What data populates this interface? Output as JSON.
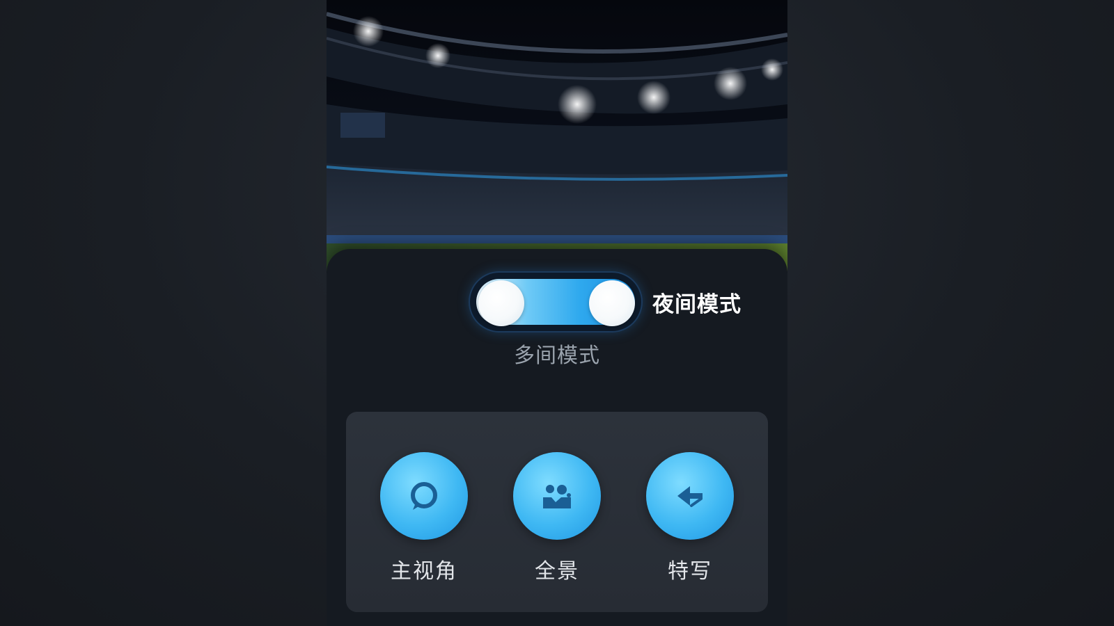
{
  "toggle": {
    "label": "夜间模式",
    "sublabel": "多间模式",
    "state": "on"
  },
  "camera_views": [
    {
      "label": "主视角",
      "icon": "rotate-view-icon"
    },
    {
      "label": "全景",
      "icon": "group-panorama-icon"
    },
    {
      "label": "特写",
      "icon": "pointer-closeup-icon"
    }
  ],
  "colors": {
    "accent": "#2fa9ee",
    "panel": "#151a21",
    "card": "#2a3038"
  }
}
